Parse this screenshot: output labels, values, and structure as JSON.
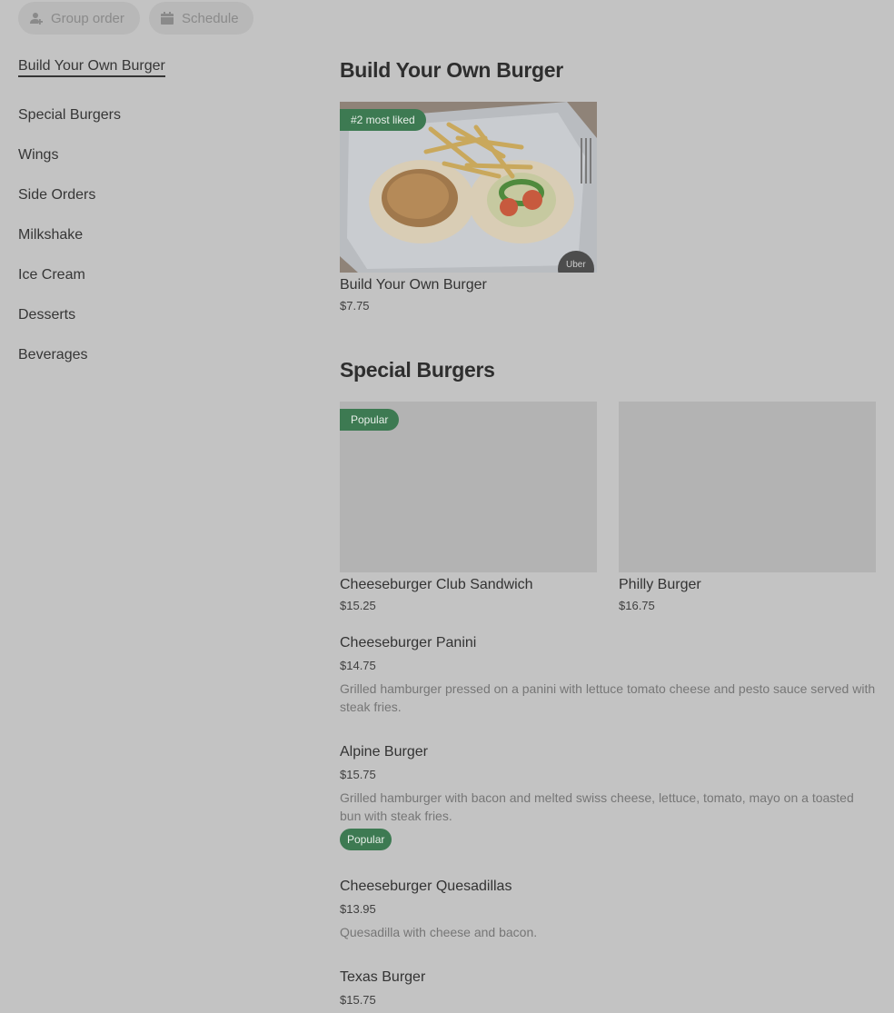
{
  "top_bar": {
    "group_order_label": "Group order",
    "schedule_label": "Schedule"
  },
  "sidebar": {
    "items": [
      {
        "label": "Build Your Own Burger",
        "active": true
      },
      {
        "label": "Special Burgers"
      },
      {
        "label": "Wings"
      },
      {
        "label": "Side Orders"
      },
      {
        "label": "Milkshake"
      },
      {
        "label": "Ice Cream"
      },
      {
        "label": "Desserts"
      },
      {
        "label": "Beverages"
      }
    ]
  },
  "sections": {
    "byob": {
      "title": "Build Your Own Burger",
      "card": {
        "badge": "#2 most liked",
        "name": "Build Your Own Burger",
        "price": "$7.75",
        "watermark": "Uber"
      }
    },
    "special": {
      "title": "Special Burgers",
      "cards": [
        {
          "badge": "Popular",
          "name": "Cheeseburger Club Sandwich",
          "price": "$15.25"
        },
        {
          "name": "Philly Burger",
          "price": "$16.75"
        }
      ],
      "items": [
        {
          "name": "Cheeseburger Panini",
          "price": "$14.75",
          "description": "Grilled hamburger pressed on a panini with lettuce tomato cheese and pesto sauce served with steak fries."
        },
        {
          "name": "Alpine Burger",
          "price": "$15.75",
          "description": "Grilled hamburger with bacon and melted swiss cheese, lettuce, tomato, mayo on a toasted bun with steak fries.",
          "badge": "Popular"
        },
        {
          "name": "Cheeseburger Quesadillas",
          "price": "$13.95",
          "description": "Quesadilla with cheese and bacon."
        },
        {
          "name": "Texas Burger",
          "price": "$15.75"
        }
      ]
    }
  },
  "colors": {
    "page_bg": "#c3c3c3",
    "badge_green": "#3d7a52"
  }
}
